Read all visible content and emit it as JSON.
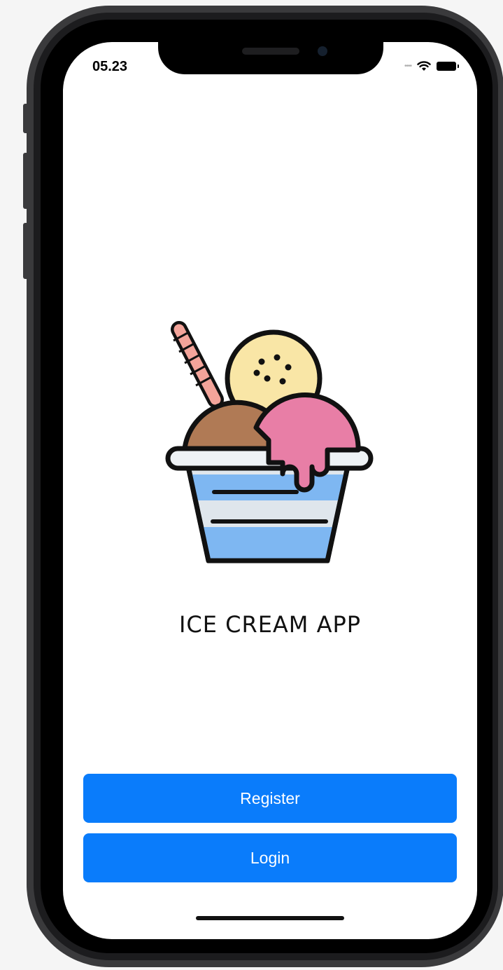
{
  "status_bar": {
    "time": "05.23",
    "icons": [
      "cellular-signal-icon",
      "wifi-icon",
      "battery-icon"
    ]
  },
  "main": {
    "illustration": "ice-cream-cup-icon",
    "title": "ICE CREAM APP"
  },
  "actions": {
    "register_label": "Register",
    "login_label": "Login"
  },
  "colors": {
    "primary_button": "#0a7cfb",
    "button_text": "#ffffff",
    "screen_background": "#ffffff",
    "scoop_chocolate": "#b07a55",
    "scoop_vanilla": "#f9e6a6",
    "scoop_strawberry": "#e87ea6",
    "cup_blue": "#7eb7f2"
  }
}
